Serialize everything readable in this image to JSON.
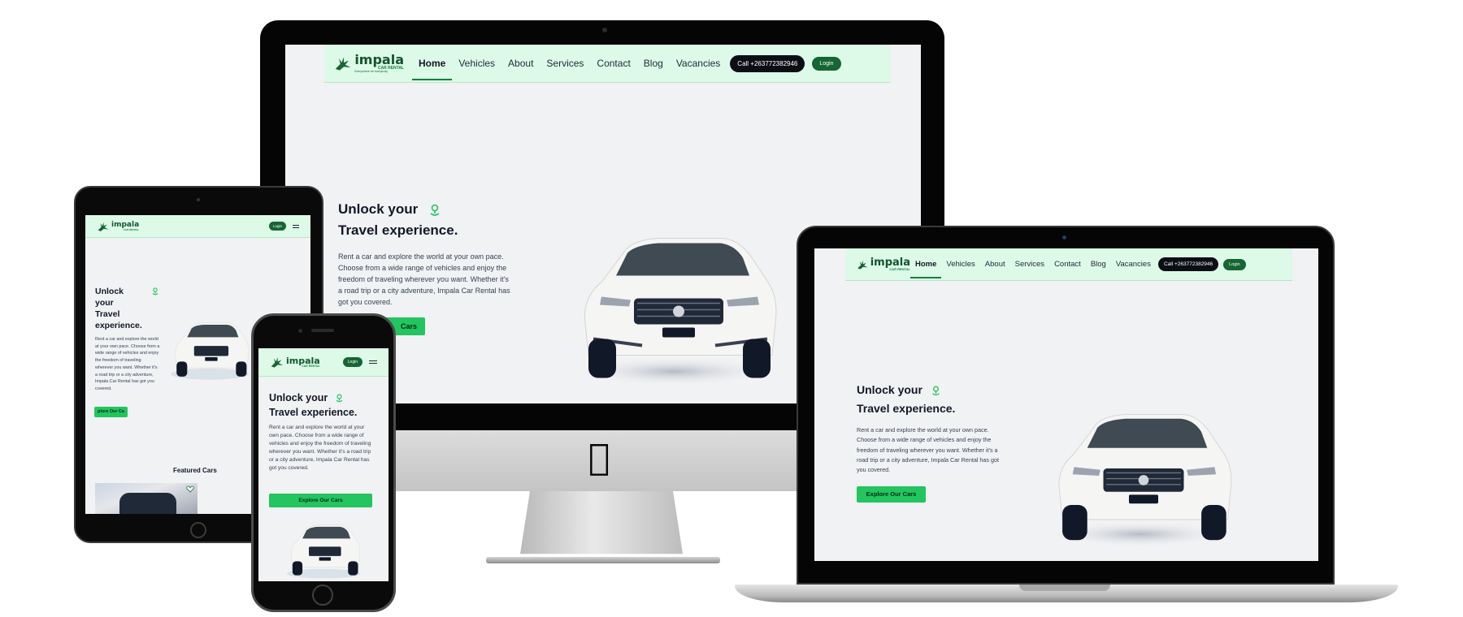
{
  "site": {
    "brand": {
      "name": "impala",
      "sub": "CAR RENTAL",
      "tagline": "Everywhere for everybody"
    },
    "nav": [
      {
        "label": "Home",
        "active": true
      },
      {
        "label": "Vehicles",
        "active": false
      },
      {
        "label": "About",
        "active": false
      },
      {
        "label": "Services",
        "active": false
      },
      {
        "label": "Contact",
        "active": false
      },
      {
        "label": "Blog",
        "active": false
      },
      {
        "label": "Vacancies",
        "active": false
      }
    ],
    "call_label": "Call +263772382946",
    "login_label": "Login",
    "hero": {
      "title_line1": "Unlock your",
      "title_line2": "Travel experience.",
      "tablet_title": [
        "Unlock",
        "your",
        "Travel",
        "experience."
      ],
      "description": "Rent a car and explore the world at your own pace. Choose from a wide range of vehicles and enjoy the freedom of traveling wherever you want. Whether it's a road trip or a city adventure, Impala Car Rental has got you covered.",
      "cta_label": "Explore Our Cars",
      "cta_partial_monitor": "Cars",
      "cta_partial_tablet": "plore Our Ca"
    },
    "featured_title": "Featured Cars"
  },
  "colors": {
    "accent_green": "#22c55e",
    "dark_green": "#166534",
    "nav_bg": "#dcfae7",
    "page_bg": "#f1f2f4"
  },
  "icons": {
    "logo": "impala-antelope-logo",
    "pin": "location-pin-icon",
    "menu": "hamburger-menu-icon",
    "heart": "heart-icon",
    "brand": "apple-logo"
  }
}
